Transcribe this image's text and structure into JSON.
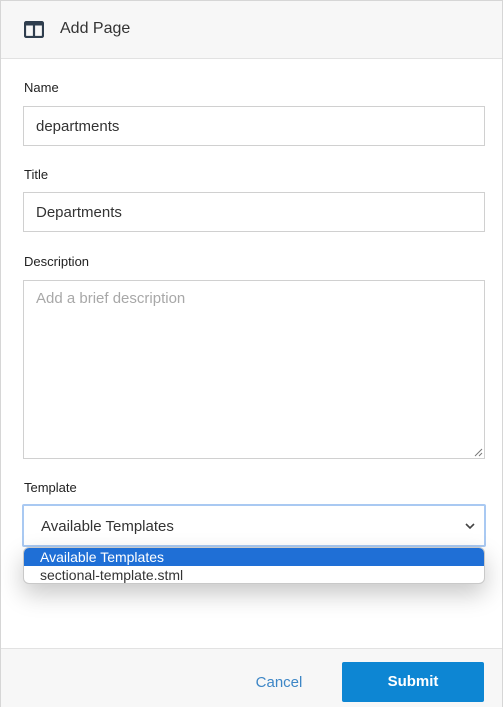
{
  "header": {
    "title": "Add Page",
    "icon": "columns-layout-icon"
  },
  "form": {
    "name": {
      "label": "Name",
      "value": "departments"
    },
    "title": {
      "label": "Title",
      "value": "Departments"
    },
    "description": {
      "label": "Description",
      "value": "",
      "placeholder": "Add a brief description"
    },
    "template": {
      "label": "Template",
      "selected": "Available Templates",
      "options": [
        "Available Templates",
        "sectional-template.stml"
      ],
      "highlighted_index": 0
    }
  },
  "footer": {
    "cancel_label": "Cancel",
    "submit_label": "Submit"
  },
  "colors": {
    "accent": "#0d86d3",
    "link": "#3d86c6",
    "option_highlight": "#1f6fd6",
    "focus_border": "#a9c9f2"
  }
}
